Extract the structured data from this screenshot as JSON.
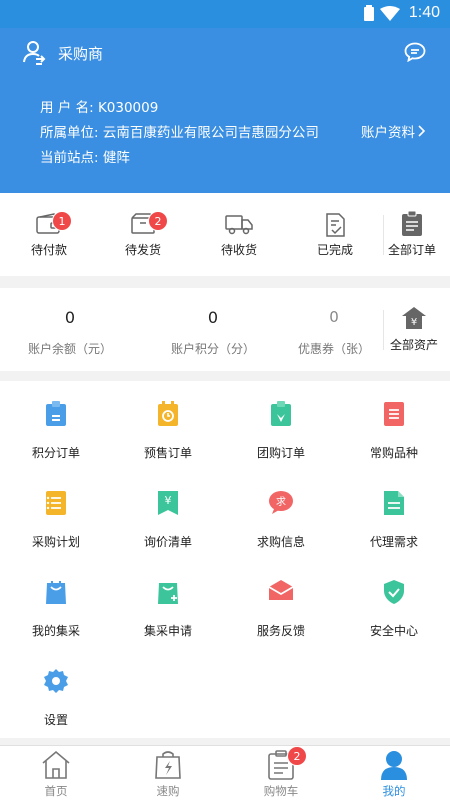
{
  "status_bar": {
    "time": "1:40"
  },
  "header": {
    "role": "采购商",
    "username_label": "用 户 名:",
    "username": "K030009",
    "company_label": "所属单位:",
    "company": "云南百康药业有限公司吉惠园分公司",
    "station_label": "当前站点:",
    "station": "健阵",
    "account_link": "账户资料"
  },
  "orders": {
    "items": [
      {
        "label": "待付款",
        "badge": "1",
        "icon": "wallet-icon"
      },
      {
        "label": "待发货",
        "badge": "2",
        "icon": "box-icon"
      },
      {
        "label": "待收货",
        "icon": "truck-icon"
      },
      {
        "label": "已完成",
        "icon": "check-doc-icon"
      }
    ],
    "all": {
      "label": "全部订单",
      "icon": "clipboard-icon"
    }
  },
  "assets": {
    "items": [
      {
        "value": "0",
        "label": "账户余额（元）"
      },
      {
        "value": "0",
        "label": "账户积分（分）"
      },
      {
        "value": "0",
        "label": "优惠券（张）"
      }
    ],
    "all": {
      "label": "全部资产",
      "icon": "yuan-house-icon"
    }
  },
  "grid": [
    {
      "label": "积分订单",
      "icon": "points-order-icon",
      "color": "#4a9ee8"
    },
    {
      "label": "预售订单",
      "icon": "presale-order-icon",
      "color": "#f5b52a"
    },
    {
      "label": "团购订单",
      "icon": "group-order-icon",
      "color": "#3cc49a"
    },
    {
      "label": "常购品种",
      "icon": "frequent-items-icon",
      "color": "#f26565"
    },
    {
      "label": "采购计划",
      "icon": "purchase-plan-icon",
      "color": "#f5b52a"
    },
    {
      "label": "询价清单",
      "icon": "inquiry-list-icon",
      "color": "#3cc49a"
    },
    {
      "label": "求购信息",
      "icon": "want-buy-icon",
      "color": "#f26565"
    },
    {
      "label": "代理需求",
      "icon": "agent-demand-icon",
      "color": "#3cc49a"
    },
    {
      "label": "我的集采",
      "icon": "my-collective-icon",
      "color": "#4a9ee8"
    },
    {
      "label": "集采申请",
      "icon": "collective-apply-icon",
      "color": "#3cc49a"
    },
    {
      "label": "服务反馈",
      "icon": "feedback-icon",
      "color": "#f26565"
    },
    {
      "label": "安全中心",
      "icon": "shield-icon",
      "color": "#3cc49a"
    },
    {
      "label": "设置",
      "icon": "settings-icon",
      "color": "#4a9ee8"
    }
  ],
  "tabbar": [
    {
      "label": "首页",
      "icon": "home-icon"
    },
    {
      "label": "速购",
      "icon": "quick-buy-icon"
    },
    {
      "label": "购物车",
      "icon": "cart-icon",
      "badge": "2"
    },
    {
      "label": "我的",
      "icon": "profile-icon",
      "active": true
    }
  ],
  "colors": {
    "primary": "#3b8fe2",
    "badge": "#f04848",
    "active_tab": "#2b8fe0"
  }
}
